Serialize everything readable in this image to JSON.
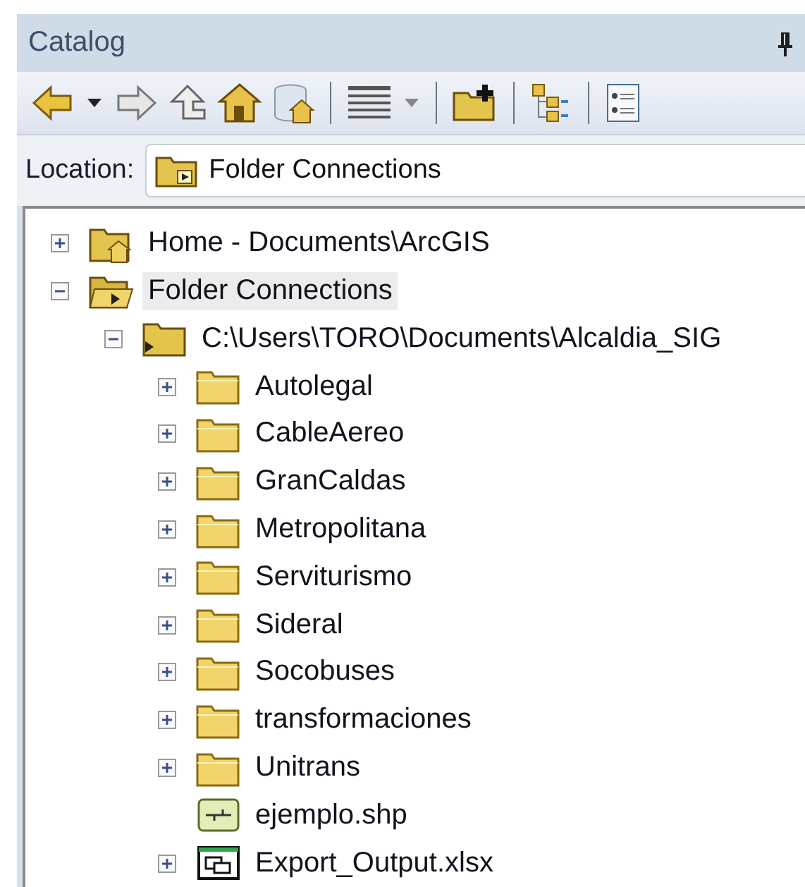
{
  "panel": {
    "title": "Catalog"
  },
  "toolbar": [
    {
      "kind": "back"
    },
    {
      "kind": "dropdown"
    },
    {
      "kind": "forward"
    },
    {
      "kind": "up"
    },
    {
      "kind": "home"
    },
    {
      "kind": "dbhome"
    },
    {
      "kind": "sep"
    },
    {
      "kind": "views"
    },
    {
      "kind": "dropdown"
    },
    {
      "kind": "sep"
    },
    {
      "kind": "connect"
    },
    {
      "kind": "sep"
    },
    {
      "kind": "tree"
    },
    {
      "kind": "sep"
    },
    {
      "kind": "options"
    }
  ],
  "location": {
    "label": "Location:",
    "value": "Folder Connections"
  },
  "tree": [
    {
      "label": "Home - Documents\\ArcGIS",
      "kind": "home",
      "expanded": false,
      "selected": false
    },
    {
      "label": "Folder Connections",
      "kind": "connections",
      "expanded": true,
      "selected": true,
      "children": [
        {
          "label": "C:\\Users\\TORO\\Documents\\Alcaldia_SIG",
          "kind": "connection",
          "expanded": true,
          "selected": false,
          "children": [
            {
              "label": "Autolegal",
              "kind": "folder",
              "expanded": false,
              "selected": false
            },
            {
              "label": "CableAereo",
              "kind": "folder",
              "expanded": false,
              "selected": false
            },
            {
              "label": "GranCaldas",
              "kind": "folder",
              "expanded": false,
              "selected": false
            },
            {
              "label": "Metropolitana",
              "kind": "folder",
              "expanded": false,
              "selected": false
            },
            {
              "label": "Serviturismo",
              "kind": "folder",
              "expanded": false,
              "selected": false
            },
            {
              "label": "Sideral",
              "kind": "folder",
              "expanded": false,
              "selected": false
            },
            {
              "label": "Socobuses",
              "kind": "folder",
              "expanded": false,
              "selected": false
            },
            {
              "label": "transformaciones",
              "kind": "folder",
              "expanded": false,
              "selected": false
            },
            {
              "label": "Unitrans",
              "kind": "folder",
              "expanded": false,
              "selected": false
            },
            {
              "label": "ejemplo.shp",
              "kind": "shapefile",
              "selected": false
            },
            {
              "label": "Export_Output.xlsx",
              "kind": "table",
              "expanded": false,
              "selected": false
            }
          ]
        }
      ]
    }
  ]
}
